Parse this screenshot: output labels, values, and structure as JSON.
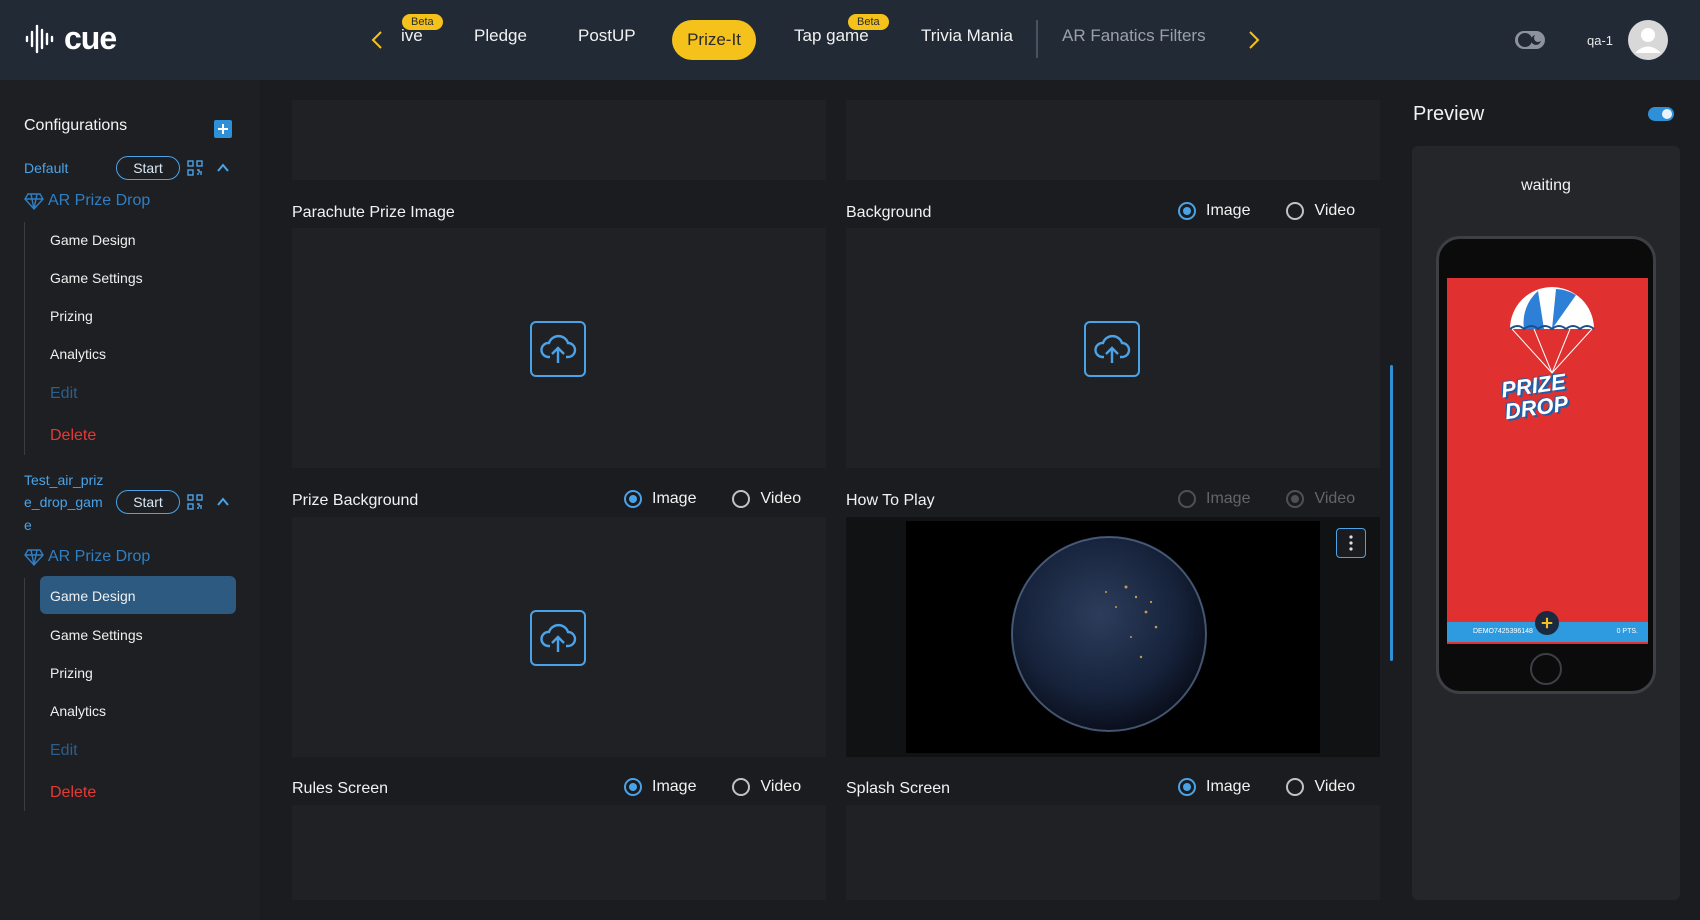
{
  "app": {
    "logo_text": "cue"
  },
  "nav": {
    "items": [
      {
        "label": "ive",
        "beta": "Beta"
      },
      {
        "label": "Pledge"
      },
      {
        "label": "PostUP"
      },
      {
        "label": "Prize-It",
        "active": true
      },
      {
        "label": "Tap game",
        "beta": "Beta"
      },
      {
        "label": "Trivia Mania"
      },
      {
        "label": "AR Fanatics Filters",
        "faded": true
      }
    ],
    "user": "qa-1"
  },
  "sidebar": {
    "title": "Configurations",
    "configs": [
      {
        "name": "Default",
        "start_label": "Start",
        "game": "AR Prize Drop",
        "menu": [
          "Game Design",
          "Game Settings",
          "Prizing",
          "Analytics"
        ],
        "edit": "Edit",
        "delete": "Delete"
      },
      {
        "name_lines": [
          "Test_air_priz",
          "e_drop_gam",
          "e"
        ],
        "start_label": "Start",
        "game": "AR Prize Drop",
        "menu": [
          "Game Design",
          "Game Settings",
          "Prizing",
          "Analytics"
        ],
        "active_menu": "Game Design",
        "edit": "Edit",
        "delete": "Delete"
      }
    ]
  },
  "main": {
    "fields": {
      "parachute": {
        "label": "Parachute Prize Image"
      },
      "background": {
        "label": "Background",
        "options": [
          "Image",
          "Video"
        ],
        "selected": "Image"
      },
      "prize_background": {
        "label": "Prize Background",
        "options": [
          "Image",
          "Video"
        ],
        "selected": "Image"
      },
      "how_to_play": {
        "label": "How To Play",
        "options": [
          "Image",
          "Video"
        ],
        "selected": "Video",
        "disabled": true
      },
      "rules_screen": {
        "label": "Rules Screen",
        "options": [
          "Image",
          "Video"
        ],
        "selected": "Image"
      },
      "splash_screen": {
        "label": "Splash Screen",
        "options": [
          "Image",
          "Video"
        ],
        "selected": "Image"
      }
    }
  },
  "preview": {
    "title": "Preview",
    "status": "waiting",
    "prize_text_1": "PRIZE",
    "prize_text_2": "DROP",
    "bar_left": "DEMO7425396148",
    "bar_right": "0 PTS."
  },
  "colors": {
    "accent": "#4aa3e8",
    "nav_active": "#f4c21b",
    "delete": "#e53935",
    "preview_bg": "#e0302f"
  }
}
